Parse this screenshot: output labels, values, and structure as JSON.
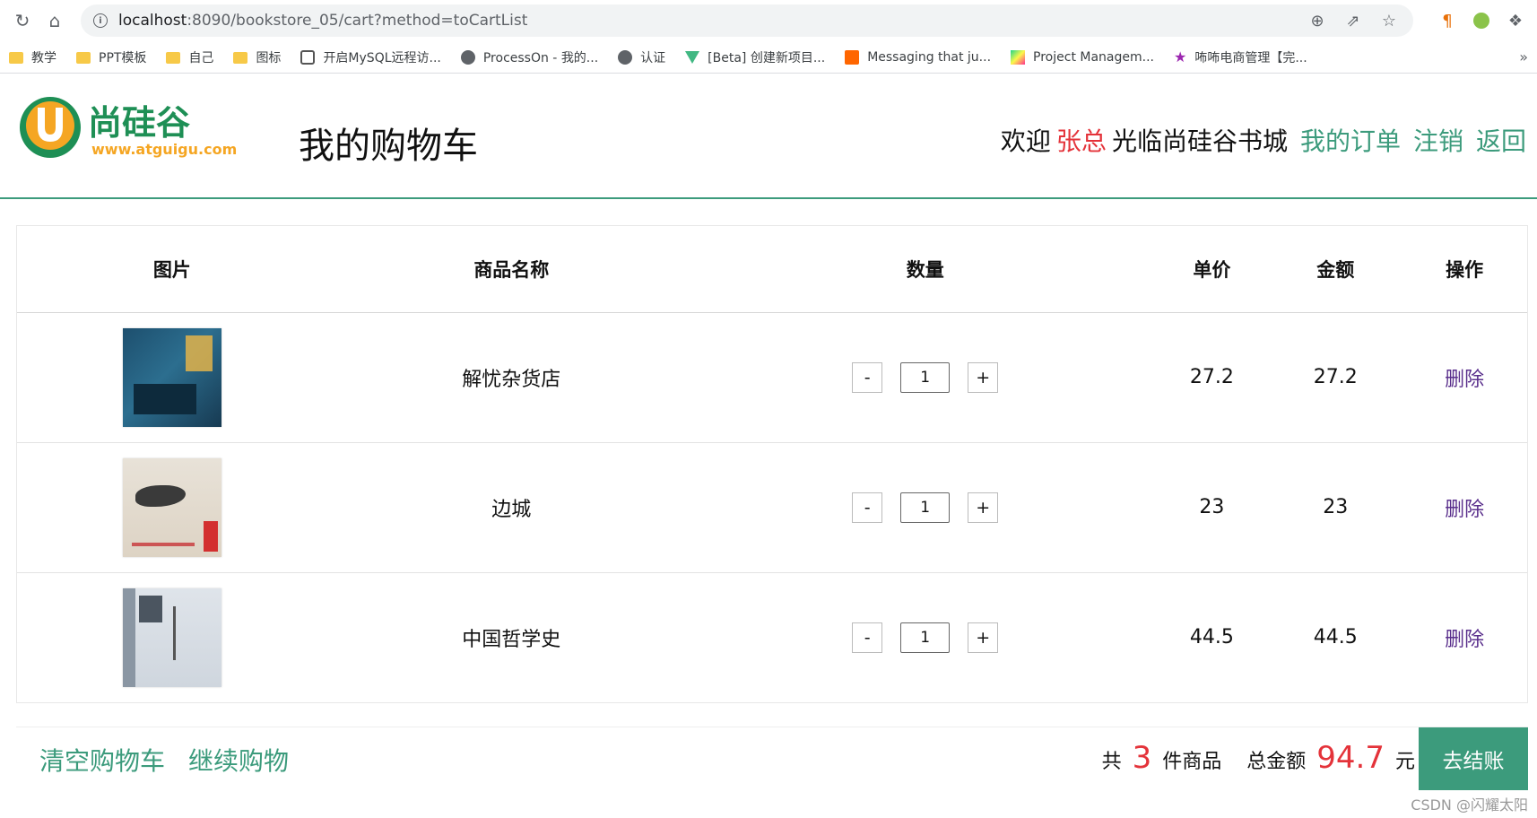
{
  "browser": {
    "url_host": "localhost",
    "url_path": ":8090/bookstore_05/cart?method=toCartList",
    "bookmarks": [
      {
        "label": "教学",
        "icon": "folder-icon"
      },
      {
        "label": "PPT模板",
        "icon": "folder-icon"
      },
      {
        "label": "自己",
        "icon": "folder-icon"
      },
      {
        "label": "图标",
        "icon": "folder-icon"
      },
      {
        "label": "开启MySQL远程访...",
        "icon": "site-icon"
      },
      {
        "label": "ProcessOn - 我的...",
        "icon": "globe-icon"
      },
      {
        "label": "认证",
        "icon": "globe-icon"
      },
      {
        "label": "[Beta] 创建新项目...",
        "icon": "vue-icon"
      },
      {
        "label": "Messaging that ju...",
        "icon": "rabbitmq-icon"
      },
      {
        "label": "Project Managem...",
        "icon": "jetbrains-icon"
      },
      {
        "label": "咘咘电商管理【完...",
        "icon": "star-icon"
      }
    ],
    "more": "»"
  },
  "header": {
    "logo_text": "尚硅谷",
    "logo_url": "www.atguigu.com",
    "title": "我的购物车",
    "welcome_prefix": "欢迎",
    "username": "张总",
    "welcome_suffix": "光临尚硅谷书城",
    "links": [
      "我的订单",
      "注销",
      "返回"
    ]
  },
  "cart": {
    "columns": [
      "图片",
      "商品名称",
      "数量",
      "单价",
      "金额",
      "操作"
    ],
    "rows": [
      {
        "name": "解忧杂货店",
        "qty": "1",
        "price": "27.2",
        "amount": "27.2",
        "action": "删除"
      },
      {
        "name": "边城",
        "qty": "1",
        "price": "23",
        "amount": "23",
        "action": "删除"
      },
      {
        "name": "中国哲学史",
        "qty": "1",
        "price": "44.5",
        "amount": "44.5",
        "action": "删除"
      }
    ],
    "minus": "-",
    "plus": "+"
  },
  "footer": {
    "clear_label": "清空购物车",
    "continue_label": "继续购物",
    "count_prefix": "共",
    "count": "3",
    "count_suffix": "件商品",
    "total_label": "总金额",
    "total": "94.7",
    "currency": "元",
    "checkout_label": "去结账",
    "watermark": "CSDN @闪耀太阳"
  },
  "colors": {
    "accent": "#3c9b7c",
    "highlight": "#e4333a",
    "link_purple": "#5a2f8c"
  }
}
